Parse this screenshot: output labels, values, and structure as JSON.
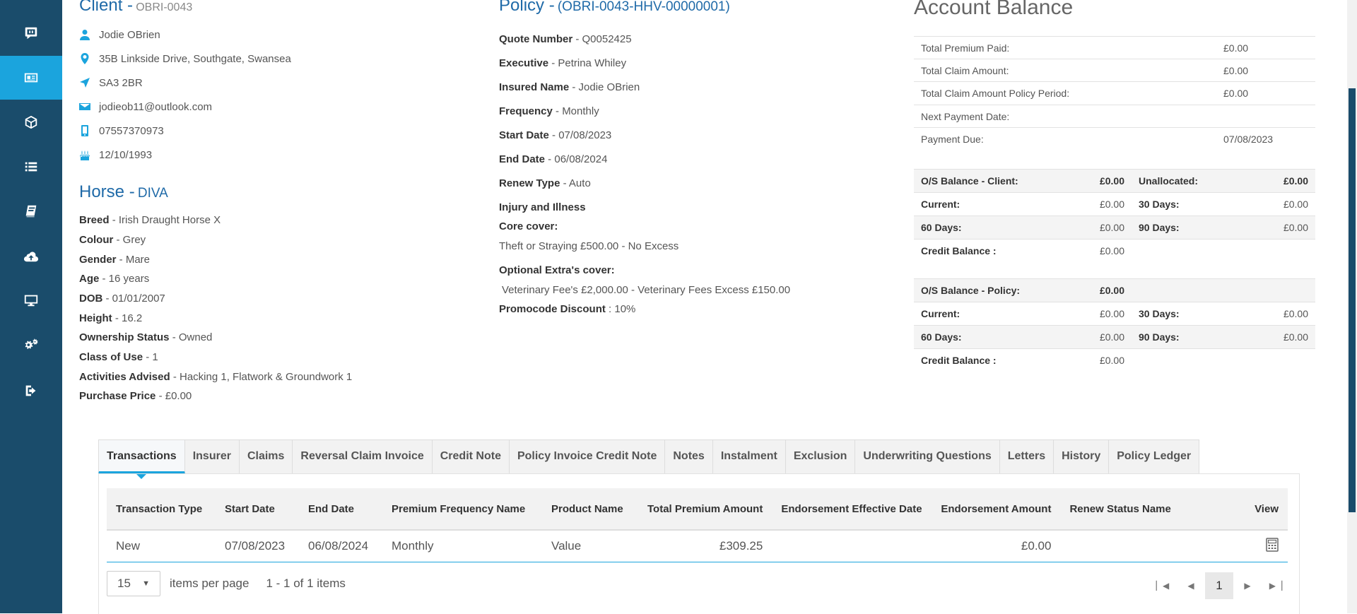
{
  "client": {
    "label": "Client -",
    "id": "OBRI-0043",
    "name": "Jodie OBrien",
    "address": "35B Linkside Drive, Southgate, Swansea",
    "postcode": "SA3 2BR",
    "email": "jodieob11@outlook.com",
    "phone": "07557370973",
    "dob": "12/10/1993"
  },
  "horse": {
    "label": "Horse -",
    "name": "DIVA",
    "fields": [
      {
        "k": "Breed",
        "v": " - Irish Draught Horse X"
      },
      {
        "k": "Colour",
        "v": " - Grey"
      },
      {
        "k": "Gender",
        "v": " - Mare"
      },
      {
        "k": "Age",
        "v": " - 16 years"
      },
      {
        "k": "DOB",
        "v": " - 01/01/2007"
      },
      {
        "k": "Height",
        "v": " - 16.2"
      },
      {
        "k": "Ownership Status",
        "v": " - Owned"
      },
      {
        "k": "Class of Use",
        "v": " - 1"
      },
      {
        "k": "Activities Advised",
        "v": " - Hacking 1, Flatwork & Groundwork 1"
      },
      {
        "k": "Purchase Price",
        "v": " - £0.00"
      }
    ]
  },
  "policy": {
    "label": "Policy -",
    "id": "(OBRI-0043-HHV-00000001)",
    "fields": [
      {
        "k": "Quote Number",
        "v": " - Q0052425"
      },
      {
        "k": "Executive",
        "v": " - Petrina Whiley"
      },
      {
        "k": "Insured Name",
        "v": " - Jodie OBrien"
      },
      {
        "k": "Frequency",
        "v": " - Monthly"
      },
      {
        "k": "Start Date",
        "v": " - 07/08/2023"
      },
      {
        "k": "End Date",
        "v": " - 06/08/2024"
      },
      {
        "k": "Renew Type",
        "v": " - Auto"
      }
    ],
    "injury_label": "Injury and Illness",
    "core_label": "Core cover:",
    "core_value": "Theft or Straying £500.00 - No Excess",
    "optional_label": "Optional Extra's cover:",
    "optional_value": "Veterinary Fee's £2,000.00 - Veterinary Fees Excess £150.00",
    "promo_label": "Promocode Discount",
    "promo_value": " : 10%"
  },
  "account_balance": {
    "title": "Account Balance",
    "rows": [
      {
        "k": "Total Premium Paid:",
        "v": "£0.00"
      },
      {
        "k": "Total Claim Amount:",
        "v": "£0.00"
      },
      {
        "k": "Total Claim Amount Policy Period:",
        "v": "£0.00"
      },
      {
        "k": "Next Payment Date:",
        "v": ""
      },
      {
        "k": "Payment Due:",
        "v": "07/08/2023"
      }
    ],
    "client_balance": {
      "os_label": "O/S Balance - Client:",
      "os_value": "£0.00",
      "unalloc_label": "Unallocated:",
      "unalloc_value": "£0.00",
      "current_label": "Current:",
      "current_value": "£0.00",
      "d30_label": "30 Days:",
      "d30_value": "£0.00",
      "d60_label": "60 Days:",
      "d60_value": "£0.00",
      "d90_label": "90 Days:",
      "d90_value": "£0.00",
      "credit_label": "Credit Balance :",
      "credit_value": "£0.00"
    },
    "policy_balance": {
      "os_label": "O/S Balance - Policy:",
      "os_value": "£0.00",
      "current_label": "Current:",
      "current_value": "£0.00",
      "d30_label": "30 Days:",
      "d30_value": "£0.00",
      "d60_label": "60 Days:",
      "d60_value": "£0.00",
      "d90_label": "90 Days:",
      "d90_value": "£0.00",
      "credit_label": "Credit Balance :",
      "credit_value": "£0.00"
    }
  },
  "tabs": [
    "Transactions",
    "Insurer",
    "Claims",
    "Reversal Claim Invoice",
    "Credit Note",
    "Policy Invoice Credit Note",
    "Notes",
    "Instalment",
    "Exclusion",
    "Underwriting Questions",
    "Letters",
    "History",
    "Policy Ledger"
  ],
  "grid": {
    "headers": [
      "Transaction Type",
      "Start Date",
      "End Date",
      "Premium Frequency Name",
      "Product Name",
      "Total Premium Amount",
      "Endorsement Effective Date",
      "Endorsement Amount",
      "Renew Status Name",
      "View"
    ],
    "rows": [
      [
        "New",
        "07/08/2023",
        "06/08/2024",
        "Monthly",
        "Value",
        "£309.25",
        "",
        "£0.00",
        ""
      ]
    ]
  },
  "pager": {
    "page_size": "15",
    "per_page_label": "items per page",
    "summary": "1 - 1 of 1 items",
    "current_page": "1"
  },
  "colors": {
    "sidebar": "#1a4c6b",
    "accent": "#1ba4dd",
    "heading": "#1f6aa8"
  }
}
